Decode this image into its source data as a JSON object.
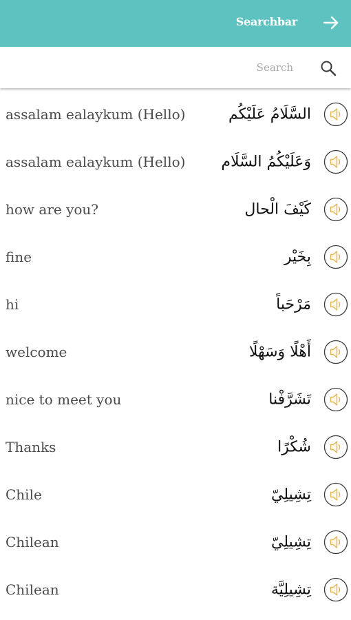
{
  "header": {
    "title": "Searchbar",
    "go_icon": "arrow-right-icon"
  },
  "search": {
    "placeholder": "Search",
    "value": "",
    "icon": "search-icon"
  },
  "phrases": [
    {
      "english": "assalam ealaykum (Hello)",
      "arabic": "السَّلَامُ عَلَيْكُم"
    },
    {
      "english": "assalam ealaykum (Hello)",
      "arabic": "وَعَلَيْكُمُ السَّلَام"
    },
    {
      "english": "how are you?",
      "arabic": "كَيْفَ الْحال"
    },
    {
      "english": "fine",
      "arabic": "بِخَيْر"
    },
    {
      "english": "hi",
      "arabic": "مَرْحَباً"
    },
    {
      "english": "welcome",
      "arabic": "أَهْلًا وَسَهْلًا"
    },
    {
      "english": "nice to meet you",
      "arabic": "تَشَرَّفْنا"
    },
    {
      "english": "Thanks",
      "arabic": "شُكْرًا"
    },
    {
      "english": "Chile",
      "arabic": "تِشِيلِيّ"
    },
    {
      "english": "Chilean",
      "arabic": "تِشِيلِيّ"
    },
    {
      "english": "Chilean",
      "arabic": "تِشِيلِيَّة"
    }
  ],
  "colors": {
    "header_bg": "#5ec2c1",
    "speaker_ring": "#3a3a3a",
    "speaker_fill": "#e8c46a"
  }
}
